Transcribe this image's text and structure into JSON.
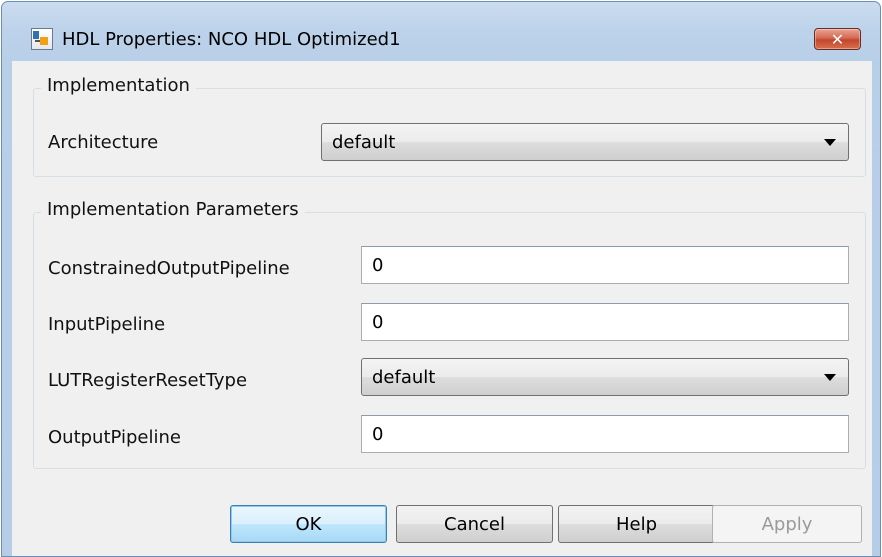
{
  "window": {
    "title": "HDL Properties: NCO HDL Optimized1",
    "close_symbol": "✕"
  },
  "implementation": {
    "legend": "Implementation",
    "architecture_label": "Architecture",
    "architecture_value": "default"
  },
  "parameters": {
    "legend": "Implementation Parameters",
    "constrained_output_pipeline_label": "ConstrainedOutputPipeline",
    "constrained_output_pipeline_value": "0",
    "input_pipeline_label": "InputPipeline",
    "input_pipeline_value": "0",
    "lut_register_reset_type_label": "LUTRegisterResetType",
    "lut_register_reset_type_value": "default",
    "output_pipeline_label": "OutputPipeline",
    "output_pipeline_value": "0"
  },
  "buttons": {
    "ok": "OK",
    "cancel": "Cancel",
    "help": "Help",
    "apply": "Apply"
  },
  "icons": {
    "app": "simulink-block-icon",
    "close": "close-icon",
    "dropdown": "chevron-down-icon"
  }
}
